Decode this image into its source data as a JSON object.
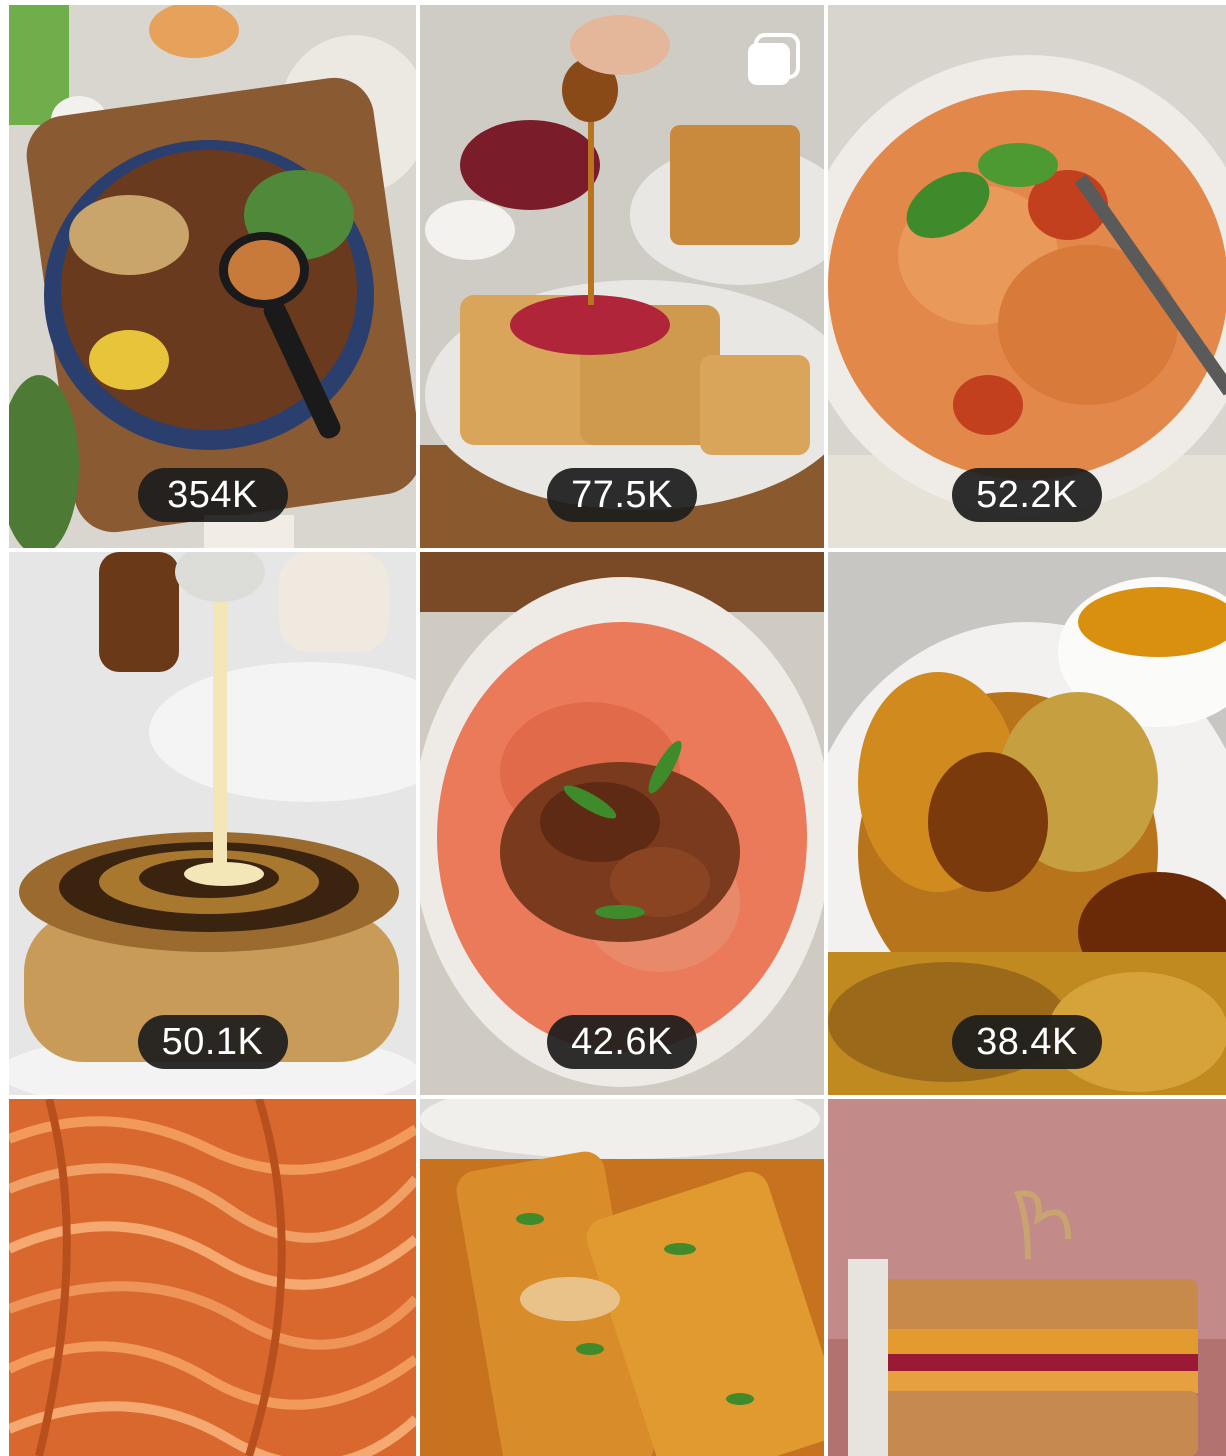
{
  "grid": {
    "posts": [
      {
        "views": "354K",
        "multi": false,
        "alt": "noodle bowl with dipping sauce"
      },
      {
        "views": "77.5K",
        "multi": true,
        "alt": "waffles with syrup"
      },
      {
        "views": "52.2K",
        "multi": false,
        "alt": "creamy tomato pasta"
      },
      {
        "views": "50.1K",
        "multi": false,
        "alt": "cinnamon roll pancakes"
      },
      {
        "views": "42.6K",
        "multi": false,
        "alt": "spaghetti bolognese"
      },
      {
        "views": "38.4K",
        "multi": false,
        "alt": "fried dish with gravy"
      },
      {
        "views": null,
        "multi": false,
        "alt": "spaghetti in tomato sauce"
      },
      {
        "views": null,
        "multi": false,
        "alt": "french toast rolls"
      },
      {
        "views": null,
        "multi": false,
        "alt": "peanut butter and jelly sandwich stack"
      }
    ]
  },
  "icons": {
    "multi_post": "carousel-icon"
  },
  "colors": {
    "badge_bg": "#1c1c1c",
    "badge_text": "#ffffff"
  }
}
